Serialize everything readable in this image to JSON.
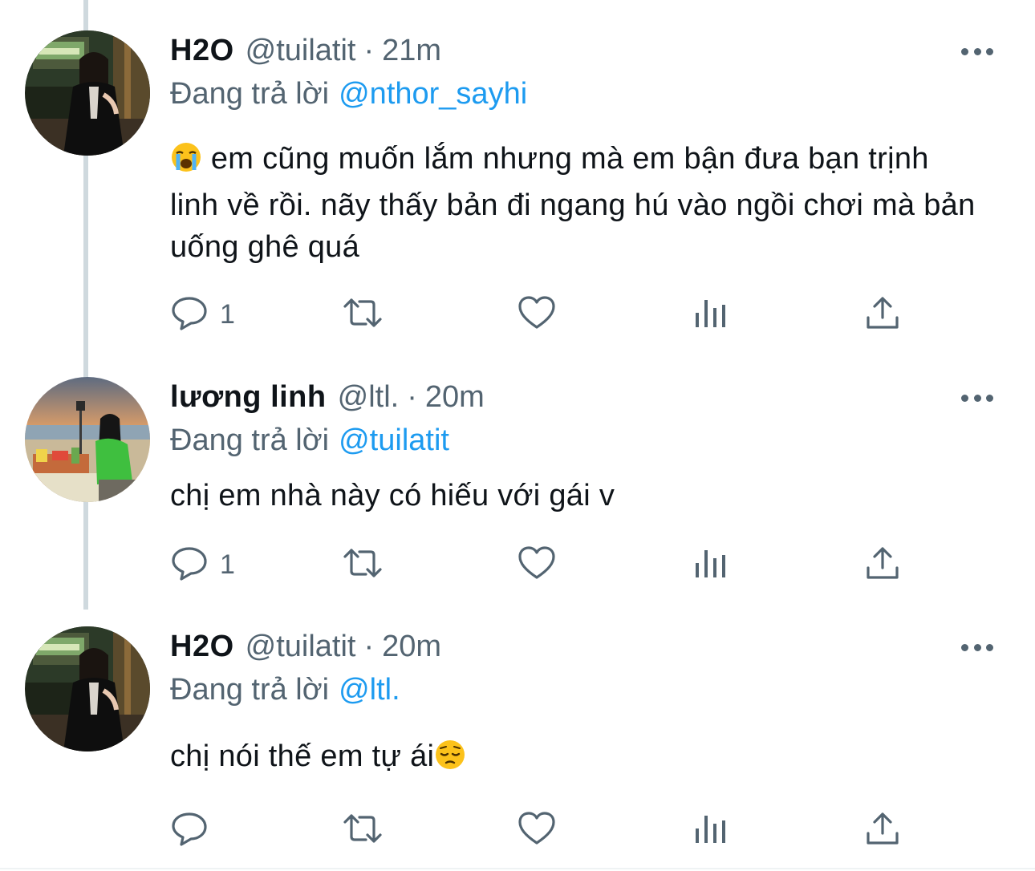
{
  "tweets": [
    {
      "name": "H2O",
      "handle": "@tuilatit",
      "separator": "·",
      "time": "21m",
      "replying_prefix": "Đang trả lời",
      "replying_to": "@nthor_sayhi",
      "emoji": "loudly-crying-face",
      "text": "em cũng muốn lắm nhưng mà em bận đưa bạn trịnh linh về rồi. nãy thấy bản đi ngang hú vào ngồi chơi mà bản uống ghê quá",
      "reply_count": "1",
      "icons": [
        "reply-icon",
        "retweet-icon",
        "like-icon",
        "analytics-icon",
        "share-icon",
        "more-icon"
      ]
    },
    {
      "name": "lương linh",
      "handle": "@ltl.",
      "separator": "·",
      "time": "20m",
      "replying_prefix": "Đang trả lời",
      "replying_to": "@tuilatit",
      "text": "chị em nhà này có hiếu với gái v",
      "reply_count": "1",
      "icons": [
        "reply-icon",
        "retweet-icon",
        "like-icon",
        "analytics-icon",
        "share-icon",
        "more-icon"
      ]
    },
    {
      "name": "H2O",
      "handle": "@tuilatit",
      "separator": "·",
      "time": "20m",
      "replying_prefix": "Đang trả lời",
      "replying_to": "@ltl.",
      "text": "chị nói thế em tự ái",
      "emoji": "pensive-face",
      "reply_count": "",
      "icons": [
        "reply-icon",
        "retweet-icon",
        "like-icon",
        "analytics-icon",
        "share-icon",
        "more-icon"
      ]
    }
  ],
  "colors": {
    "text": "#0f1419",
    "secondary": "#536471",
    "link": "#1d9bf0",
    "thread_line": "#cfd9de"
  }
}
